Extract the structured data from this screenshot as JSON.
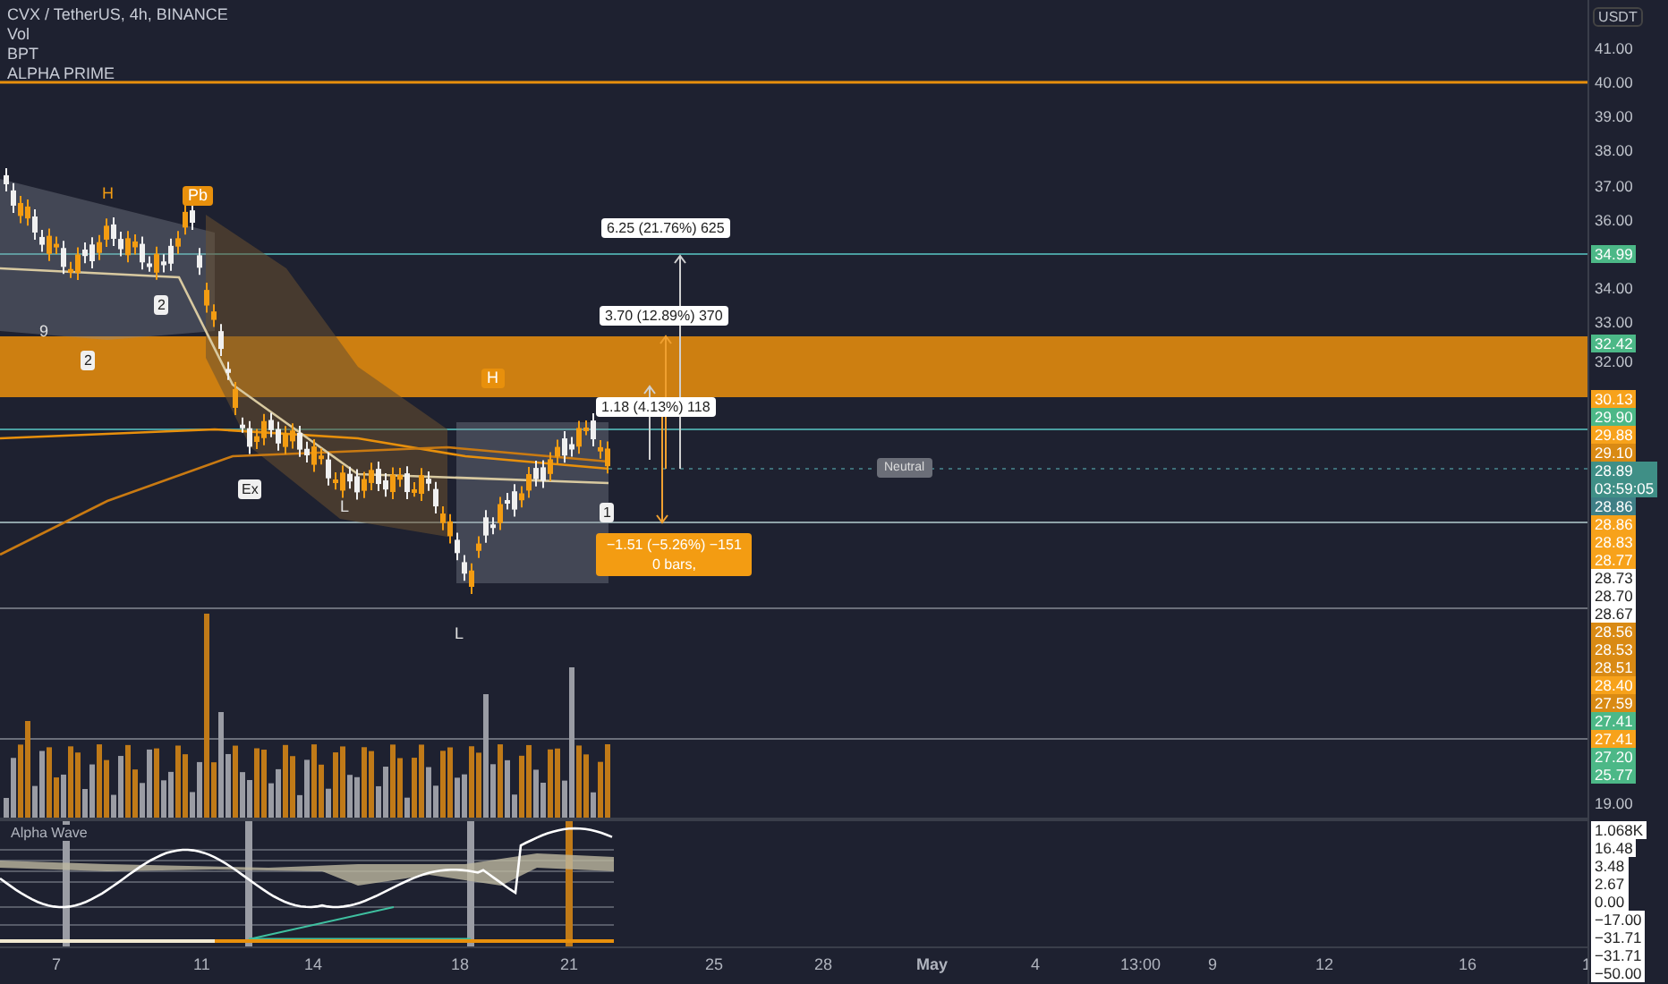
{
  "legend": [
    "CVX / TetherUS, 4h, BINANCE",
    "Vol",
    "BPT",
    "ALPHA PRIME"
  ],
  "annotations": [
    {
      "text": "H",
      "kind": "marker"
    },
    {
      "text": "Pb",
      "kind": "tag"
    },
    {
      "text": "9",
      "kind": "note"
    },
    {
      "text": "2",
      "kind": "badge"
    },
    {
      "text": "2",
      "kind": "badge"
    },
    {
      "text": "Ex",
      "kind": "badge"
    },
    {
      "text": "L",
      "kind": "note"
    },
    {
      "text": "L",
      "kind": "note"
    },
    {
      "text": "H",
      "kind": "tag"
    },
    {
      "text": "6.25 (21.76%) 625",
      "kind": "measure"
    },
    {
      "text": "3.70 (12.89%) 370",
      "kind": "measure"
    },
    {
      "text": "1.18 (4.13%) 118",
      "kind": "measure"
    },
    {
      "text": "1",
      "kind": "badge"
    },
    {
      "text": "−1.51 (−5.26%) −151",
      "kind": "loss",
      "note": "0 bars,"
    },
    {
      "text": "Neutral",
      "kind": "neutral"
    }
  ],
  "price_axis": {
    "unit": "USDT",
    "labels": [
      {
        "text": "41.00",
        "kind": "plain"
      },
      {
        "text": "40.00",
        "kind": "plain"
      },
      {
        "text": "39.00",
        "kind": "plain"
      },
      {
        "text": "38.00",
        "kind": "plain"
      },
      {
        "text": "37.00",
        "kind": "plain"
      },
      {
        "text": "36.00",
        "kind": "plain"
      },
      {
        "text": "34.99",
        "kind": "green"
      },
      {
        "text": "34.00",
        "kind": "plain"
      },
      {
        "text": "33.00",
        "kind": "plain"
      },
      {
        "text": "32.42",
        "kind": "green"
      },
      {
        "text": "32.00",
        "kind": "plain"
      },
      {
        "text": "30.13",
        "kind": "orange"
      },
      {
        "text": "29.90",
        "kind": "green"
      },
      {
        "text": "29.88",
        "kind": "orange"
      },
      {
        "text": "29.10",
        "kind": "amber"
      },
      {
        "text": "28.89",
        "kind": "countdown",
        "time": "03:59:05"
      },
      {
        "text": "28.86",
        "kind": "teal"
      },
      {
        "text": "28.86",
        "kind": "orange"
      },
      {
        "text": "28.83",
        "kind": "orange"
      },
      {
        "text": "28.77",
        "kind": "orange"
      },
      {
        "text": "28.73",
        "kind": "white"
      },
      {
        "text": "28.70",
        "kind": "white"
      },
      {
        "text": "28.67",
        "kind": "white"
      },
      {
        "text": "28.56",
        "kind": "amber"
      },
      {
        "text": "28.53",
        "kind": "amber"
      },
      {
        "text": "28.51",
        "kind": "amber"
      },
      {
        "text": "28.40",
        "kind": "orange"
      },
      {
        "text": "27.59",
        "kind": "amber"
      },
      {
        "text": "27.41",
        "kind": "green"
      },
      {
        "text": "27.41",
        "kind": "orange"
      },
      {
        "text": "27.20",
        "kind": "green"
      },
      {
        "text": "25.77",
        "kind": "green"
      },
      {
        "text": "19.00",
        "kind": "plain"
      }
    ]
  },
  "oscillator": {
    "title": "Alpha Wave",
    "labels": [
      "1.068K",
      "16.48",
      "3.48",
      "2.67",
      "0.00",
      "−17.00",
      "−31.71",
      "−31.71",
      "−50.00"
    ]
  },
  "time_axis": [
    {
      "text": "7",
      "bold": false
    },
    {
      "text": "11",
      "bold": false
    },
    {
      "text": "14",
      "bold": false
    },
    {
      "text": "18",
      "bold": false
    },
    {
      "text": "21",
      "bold": false
    },
    {
      "text": "25",
      "bold": false
    },
    {
      "text": "28",
      "bold": false
    },
    {
      "text": "May",
      "bold": true
    },
    {
      "text": "4",
      "bold": false
    },
    {
      "text": "13:00",
      "bold": false
    },
    {
      "text": "9",
      "bold": false
    },
    {
      "text": "12",
      "bold": false
    },
    {
      "text": "16",
      "bold": false
    },
    {
      "text": "1",
      "bold": false
    }
  ]
}
